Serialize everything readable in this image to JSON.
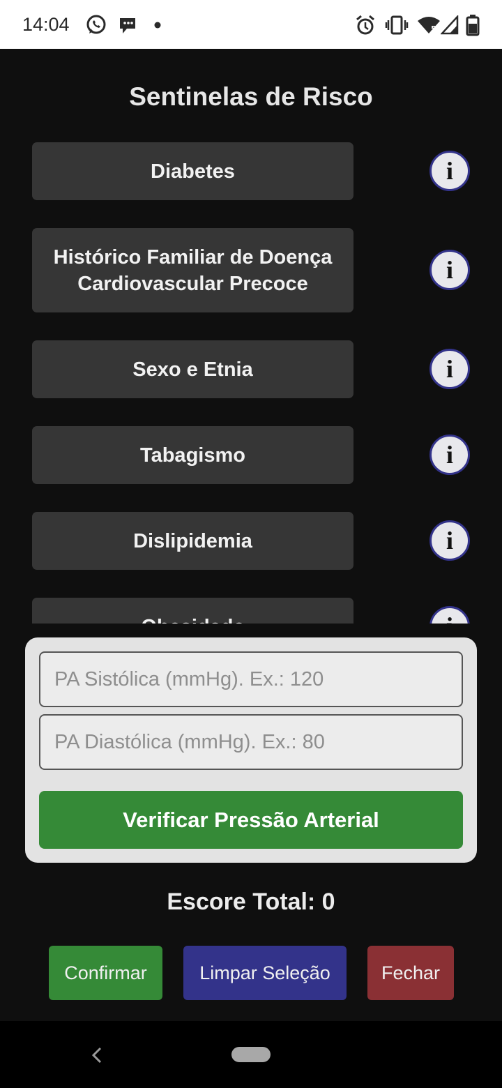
{
  "status_bar": {
    "time": "14:04",
    "left_icons": [
      "whatsapp-icon",
      "chat-bubble-icon",
      "dot-icon"
    ],
    "right_icons": [
      "alarm-icon",
      "vibrate-icon",
      "wifi-icon",
      "signal-icon",
      "battery-icon"
    ]
  },
  "page": {
    "title": "Sentinelas de Risco"
  },
  "sentinels": [
    {
      "label": "Diabetes"
    },
    {
      "label": "Histórico Familiar de Doença Cardiovascular Precoce"
    },
    {
      "label": "Sexo e Etnia"
    },
    {
      "label": "Tabagismo"
    },
    {
      "label": "Dislipidemia"
    },
    {
      "label": "Obesidade"
    }
  ],
  "info_glyph": "i",
  "blood_pressure": {
    "systolic_placeholder": "PA Sistólica (mmHg). Ex.: 120",
    "diastolic_placeholder": "PA Diastólica (mmHg). Ex.: 80",
    "check_button": "Verificar Pressão Arterial"
  },
  "score": {
    "text": "Escore Total: 0"
  },
  "actions": {
    "confirm": "Confirmar",
    "clear": "Limpar Seleção",
    "close": "Fechar"
  },
  "colors": {
    "background": "#0f0f0f",
    "item_button": "#363636",
    "info_border": "#33338a",
    "green": "#358a37",
    "blue": "#33338a",
    "red": "#8a3034"
  }
}
